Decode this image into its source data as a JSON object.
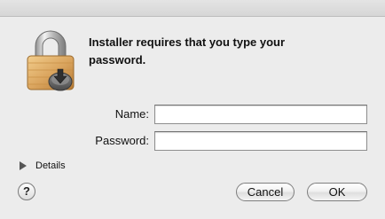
{
  "dialog": {
    "heading_line1": "Installer requires that you type your",
    "heading_line2": "password."
  },
  "form": {
    "name_label": "Name:",
    "name_value": "",
    "password_label": "Password:",
    "password_value": ""
  },
  "details": {
    "label": "Details"
  },
  "buttons": {
    "help_label": "?",
    "cancel_label": "Cancel",
    "ok_label": "OK"
  },
  "icons": {
    "lock": "lock-icon",
    "disclosure": "disclosure-triangle-icon",
    "help": "help-icon"
  },
  "colors": {
    "window_background": "#ececec",
    "lock_body": "#d9a35a",
    "shackle": "#b8b8b8"
  }
}
